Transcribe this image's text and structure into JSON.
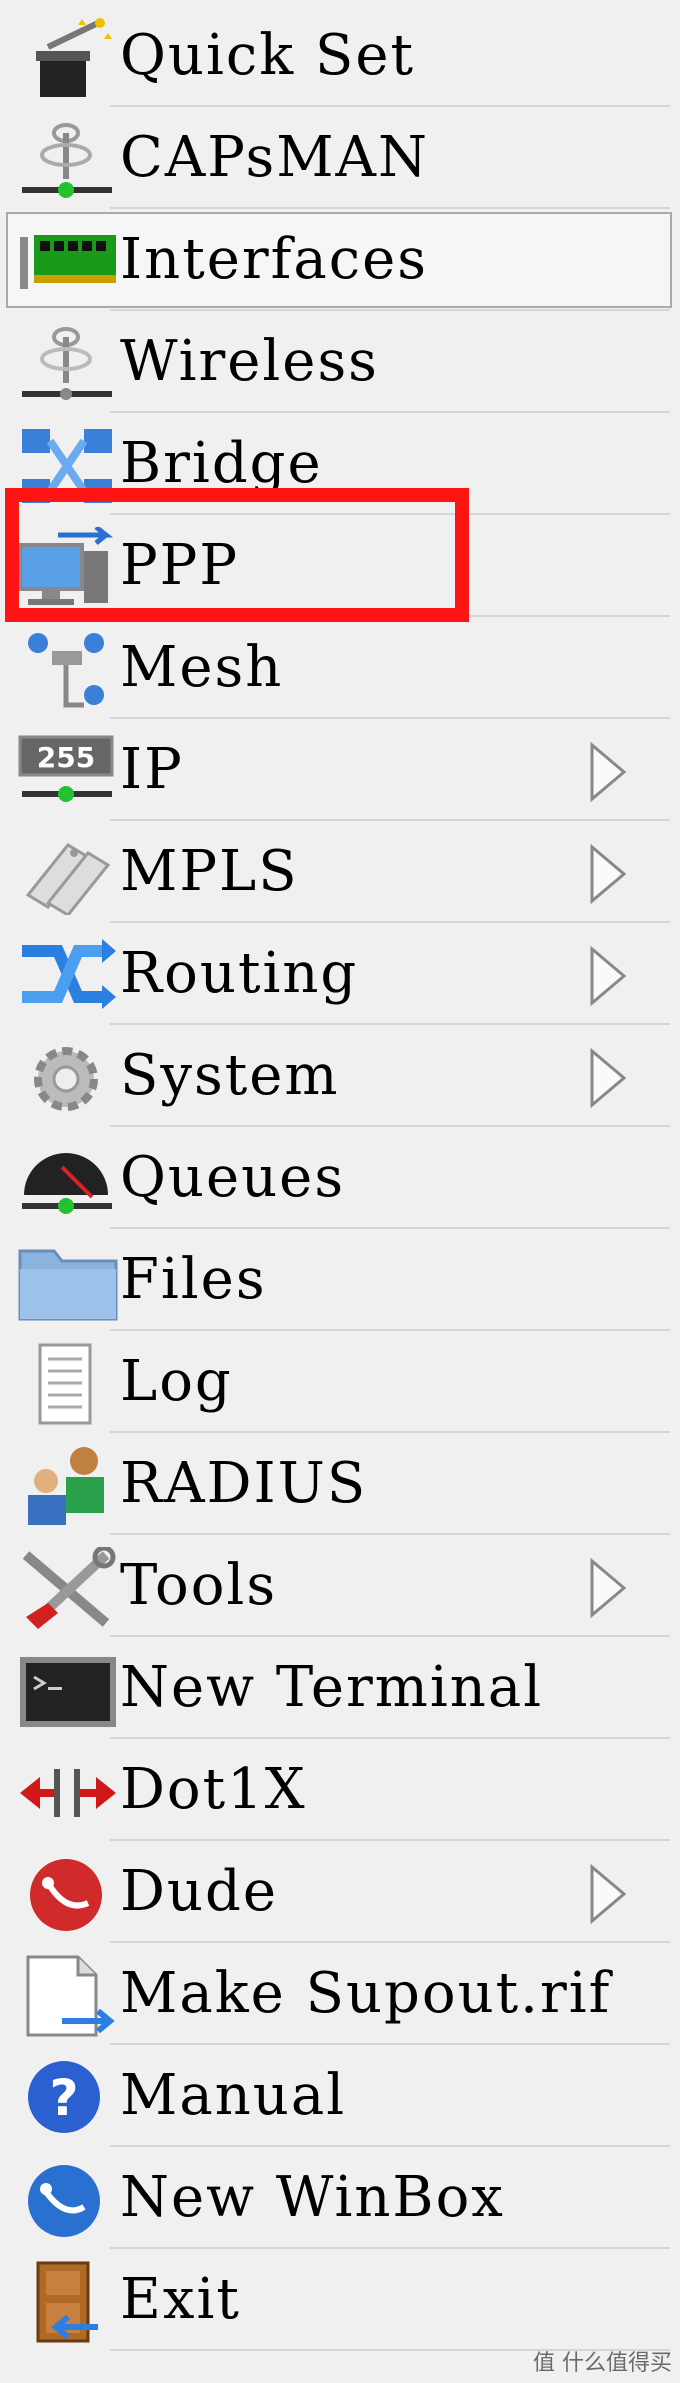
{
  "menu": {
    "items": [
      {
        "label": "Quick Set",
        "icon": "quick-set-icon",
        "submenu": false
      },
      {
        "label": "CAPsMAN",
        "icon": "capsman-icon",
        "submenu": false
      },
      {
        "label": "Interfaces",
        "icon": "interfaces-icon",
        "submenu": false,
        "selected": true
      },
      {
        "label": "Wireless",
        "icon": "wireless-icon",
        "submenu": false
      },
      {
        "label": "Bridge",
        "icon": "bridge-icon",
        "submenu": false
      },
      {
        "label": "PPP",
        "icon": "ppp-icon",
        "submenu": false,
        "highlighted": true
      },
      {
        "label": "Mesh",
        "icon": "mesh-icon",
        "submenu": false
      },
      {
        "label": "IP",
        "icon": "ip-icon",
        "submenu": true
      },
      {
        "label": "MPLS",
        "icon": "mpls-icon",
        "submenu": true
      },
      {
        "label": "Routing",
        "icon": "routing-icon",
        "submenu": true
      },
      {
        "label": "System",
        "icon": "system-gear-icon",
        "submenu": true
      },
      {
        "label": "Queues",
        "icon": "queues-icon",
        "submenu": false
      },
      {
        "label": "Files",
        "icon": "folder-icon",
        "submenu": false
      },
      {
        "label": "Log",
        "icon": "log-icon",
        "submenu": false
      },
      {
        "label": "RADIUS",
        "icon": "radius-users-icon",
        "submenu": false
      },
      {
        "label": "Tools",
        "icon": "tools-icon",
        "submenu": true
      },
      {
        "label": "New Terminal",
        "icon": "terminal-icon",
        "submenu": false
      },
      {
        "label": "Dot1X",
        "icon": "dot1x-icon",
        "submenu": false
      },
      {
        "label": "Dude",
        "icon": "dude-icon",
        "submenu": true
      },
      {
        "label": "Make Supout.rif",
        "icon": "supout-file-icon",
        "submenu": false
      },
      {
        "label": "Manual",
        "icon": "manual-help-icon",
        "submenu": false
      },
      {
        "label": "New WinBox",
        "icon": "winbox-icon",
        "submenu": false
      },
      {
        "label": "Exit",
        "icon": "exit-door-icon",
        "submenu": false
      }
    ]
  },
  "colors": {
    "background": "#f0f0f0",
    "highlight_border": "#ff1414",
    "divider": "#d6d6d6"
  },
  "watermark": "值 什么值得买"
}
